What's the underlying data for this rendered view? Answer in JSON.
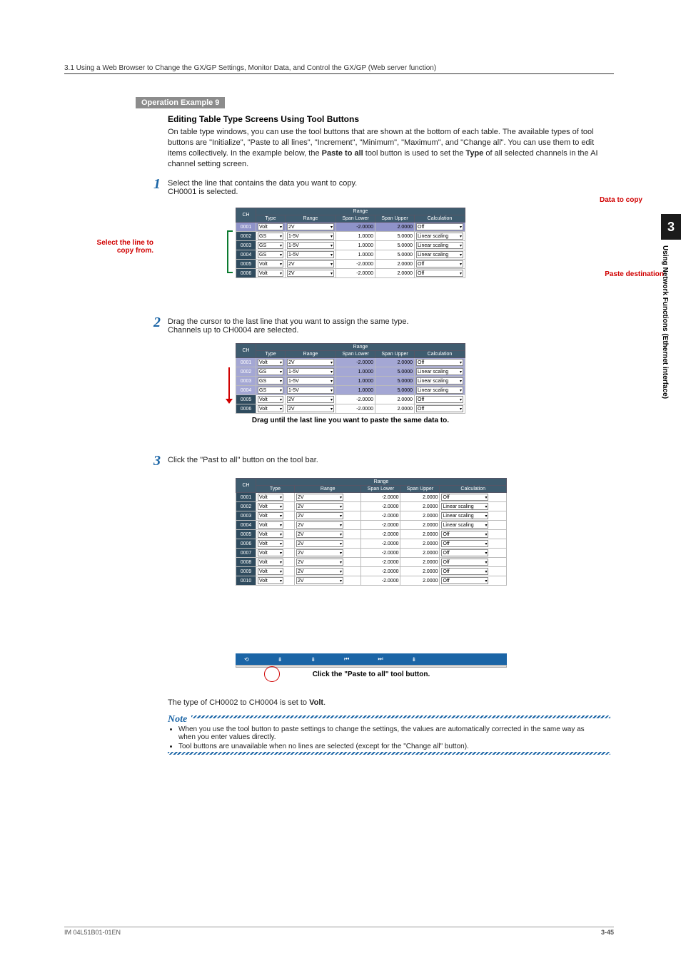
{
  "section_header": "3.1  Using a Web Browser to Change the GX/GP Settings, Monitor Data, and Control the GX/GP (Web server function)",
  "op_example": "Operation Example 9",
  "subheading": "Editing Table Type Screens Using Tool Buttons",
  "intro_body": "On table type windows, you can use the tool buttons that are shown at the bottom of each table. The available types of tool buttons are \"Initialize\", \"Paste to all lines\", \"Increment\", \"Minimum\", \"Maximum\", and \"Change all\". You can use them to edit items collectively. In the example below, the ",
  "intro_b1": "Paste to all",
  "intro_mid": " tool button is used to set the ",
  "intro_b2": "Type",
  "intro_tail": " of all selected channels in the AI channel setting screen.",
  "step1_text": "Select the line that contains the data you want to copy.",
  "step1_sub": "CH0001 is selected.",
  "label_data_to_copy": "Data to copy",
  "label_select_line": "Select the line to copy from.",
  "label_paste_dest": "Paste destination",
  "table_headers": {
    "ch": "CH",
    "type": "Type",
    "range": "Range",
    "range_group": "Range",
    "span_lower": "Span Lower",
    "span_upper": "Span Upper",
    "calc": "Calculation"
  },
  "t1": [
    {
      "ch": "0001",
      "type": "Volt",
      "range": "2V",
      "lo": "-2.0000",
      "up": "2.0000",
      "calc": "Off",
      "sel": true
    },
    {
      "ch": "0002",
      "type": "GS",
      "range": "1-5V",
      "lo": "1.0000",
      "up": "5.0000",
      "calc": "Linear scaling"
    },
    {
      "ch": "0003",
      "type": "GS",
      "range": "1-5V",
      "lo": "1.0000",
      "up": "5.0000",
      "calc": "Linear scaling"
    },
    {
      "ch": "0004",
      "type": "GS",
      "range": "1-5V",
      "lo": "1.0000",
      "up": "5.0000",
      "calc": "Linear scaling"
    },
    {
      "ch": "0005",
      "type": "Volt",
      "range": "2V",
      "lo": "-2.0000",
      "up": "2.0000",
      "calc": "Off"
    },
    {
      "ch": "0006",
      "type": "Volt",
      "range": "2V",
      "lo": "-2.0000",
      "up": "2.0000",
      "calc": "Off"
    }
  ],
  "step2_text": "Drag the cursor to the last line that you want to assign the same type.",
  "step2_sub": "Channels up to CH0004 are selected.",
  "t2_caption": "Drag until the last line you want to paste the same data to.",
  "step3_text": "Click the \"Past to all\" button on the tool bar.",
  "t3": [
    {
      "ch": "0001",
      "type": "Volt",
      "range": "2V",
      "lo": "-2.0000",
      "up": "2.0000",
      "calc": "Off"
    },
    {
      "ch": "0002",
      "type": "Volt",
      "range": "2V",
      "lo": "-2.0000",
      "up": "2.0000",
      "calc": "Linear scaling"
    },
    {
      "ch": "0003",
      "type": "Volt",
      "range": "2V",
      "lo": "-2.0000",
      "up": "2.0000",
      "calc": "Linear scaling"
    },
    {
      "ch": "0004",
      "type": "Volt",
      "range": "2V",
      "lo": "-2.0000",
      "up": "2.0000",
      "calc": "Linear scaling"
    },
    {
      "ch": "0005",
      "type": "Volt",
      "range": "2V",
      "lo": "-2.0000",
      "up": "2.0000",
      "calc": "Off"
    },
    {
      "ch": "0006",
      "type": "Volt",
      "range": "2V",
      "lo": "-2.0000",
      "up": "2.0000",
      "calc": "Off"
    },
    {
      "ch": "0007",
      "type": "Volt",
      "range": "2V",
      "lo": "-2.0000",
      "up": "2.0000",
      "calc": "Off"
    },
    {
      "ch": "0008",
      "type": "Volt",
      "range": "2V",
      "lo": "-2.0000",
      "up": "2.0000",
      "calc": "Off"
    },
    {
      "ch": "0009",
      "type": "Volt",
      "range": "2V",
      "lo": "-2.0000",
      "up": "2.0000",
      "calc": "Off"
    },
    {
      "ch": "0010",
      "type": "Volt",
      "range": "2V",
      "lo": "-2.0000",
      "up": "2.0000",
      "calc": "Off"
    }
  ],
  "t3_tool_caption": "Click the \"Paste to all\" tool button.",
  "t3_result_a": "The type of CH0002 to CH0004 is set to ",
  "t3_result_b": "Volt",
  "note_heading": "Note",
  "note1": "When you use the tool button to paste settings to change the settings, the values are automatically corrected in the same way as when you enter values directly.",
  "note2": "Tool buttons are unavailable when no lines are selected (except for the \"Change all\" button).",
  "footer_left": "IM 04L51B01-01EN",
  "footer_right": "3-45",
  "chapter_num": "3",
  "chapter_title": "Using Network Functions (Ethernet interface)"
}
